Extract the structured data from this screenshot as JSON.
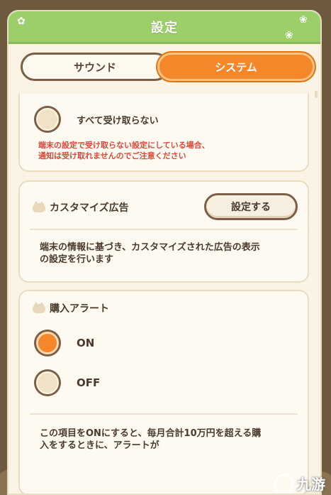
{
  "header": {
    "title": "設定"
  },
  "tabs": [
    {
      "label": "サウンド",
      "active": false
    },
    {
      "label": "システム",
      "active": true
    }
  ],
  "notification": {
    "option_none_label": "すべて受け取らない",
    "option_none_selected": false,
    "warning_line1": "端末の設定で受け取らない設定にしている場合、",
    "warning_line2": "通知は受け取れませんのでご注意ください"
  },
  "custom_ads": {
    "title": "カスタマイズ広告",
    "button_label": "設定する",
    "description_line1": "端末の情報に基づき、カスタマイズされた広告の表示",
    "description_line2": "の設定を行います"
  },
  "purchase_alert": {
    "title": "購入アラート",
    "options": [
      {
        "label": "ON",
        "selected": true
      },
      {
        "label": "OFF",
        "selected": false
      }
    ],
    "description_line1": "この項目をONにすると、毎月合計10万円を超える購",
    "description_line2": "入をするときに、アラートが"
  },
  "colors": {
    "header_green": "#9ccf6a",
    "accent_orange": "#f4872a",
    "warning_red": "#d9483a",
    "text_brown": "#4a3a2c"
  },
  "watermark": {
    "text": "九游"
  }
}
